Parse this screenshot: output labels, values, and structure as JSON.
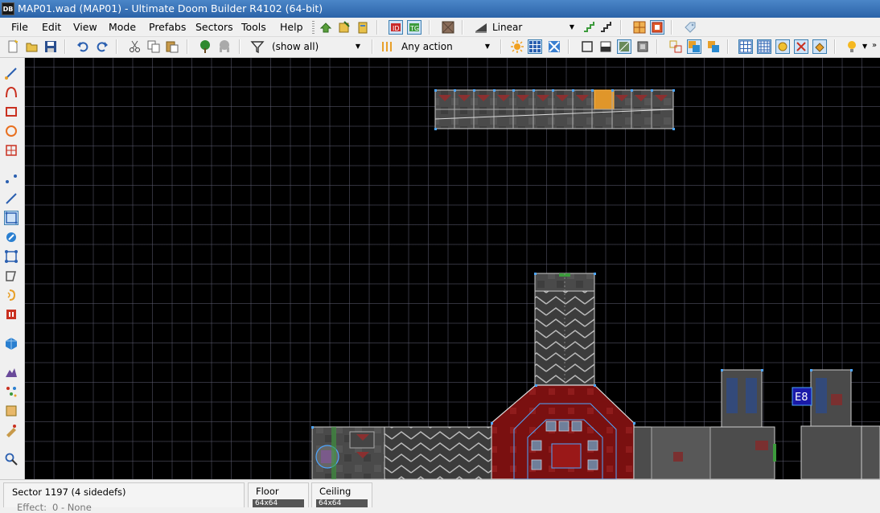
{
  "window": {
    "title": "MAP01.wad (MAP01) - Ultimate Doom Builder R4102 (64-bit)",
    "app_icon_text": "DB"
  },
  "menu": [
    "File",
    "Edit",
    "View",
    "Mode",
    "Prefabs",
    "Sectors",
    "Tools",
    "Help"
  ],
  "toolbar": {
    "filter_mode": "Linear",
    "things_filter": "(show all)",
    "action_filter": "Any action"
  },
  "map": {
    "tag_label": "E8"
  },
  "info_panel": {
    "sector_title": "Sector 1197 (4 sidedefs)",
    "effect_label": "Effect:",
    "effect_value": "0 - None",
    "floor_label": "Floor",
    "ceiling_label": "Ceiling",
    "floor_size": "64x64",
    "ceiling_size": "64x64"
  },
  "colors": {
    "accent": "#3c7fb1",
    "map_background": "#000000",
    "vertex": "#4da6ff",
    "selected_sector": "#8b1a1a",
    "tag_box": "#1a1aa8"
  }
}
